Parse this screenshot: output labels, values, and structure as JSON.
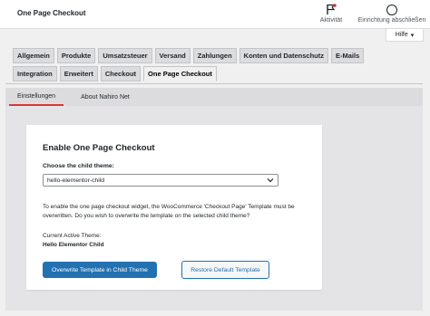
{
  "header": {
    "title": "One Page Checkout",
    "activity_label": "Aktivität",
    "finish_label": "Einrichtung abschließen",
    "help_label": "Hilfe"
  },
  "tabs": {
    "row1": [
      "Allgemein",
      "Produkte",
      "Umsatzsteuer",
      "Versand",
      "Zahlungen",
      "Konten und Datenschutz",
      "E-Mails"
    ],
    "row2": [
      "Integration",
      "Erweitert",
      "Checkout",
      "One Page Checkout"
    ],
    "active": "One Page Checkout"
  },
  "subnav": {
    "items": [
      "Einstellungen",
      "About Nahiro Net"
    ],
    "active": "Einstellungen"
  },
  "card": {
    "title": "Enable One Page Checkout",
    "select_label": "Choose the child theme:",
    "select_value": "hello-elementor-child",
    "description": "To enable the one page checkout widget, the WooCommerce 'Checkout Page' Template must be overwritten. Do you wish to overwrite the template on the selected child theme?",
    "current_label": "Current Active Theme:",
    "current_value": "Hello Elementor Child",
    "primary_button": "Overwrite Template in Child Theme",
    "secondary_button": "Restore Default Template"
  },
  "colors": {
    "accent": "#2271b1",
    "active_indicator": "#d63638",
    "background": "#f0f0f1"
  }
}
